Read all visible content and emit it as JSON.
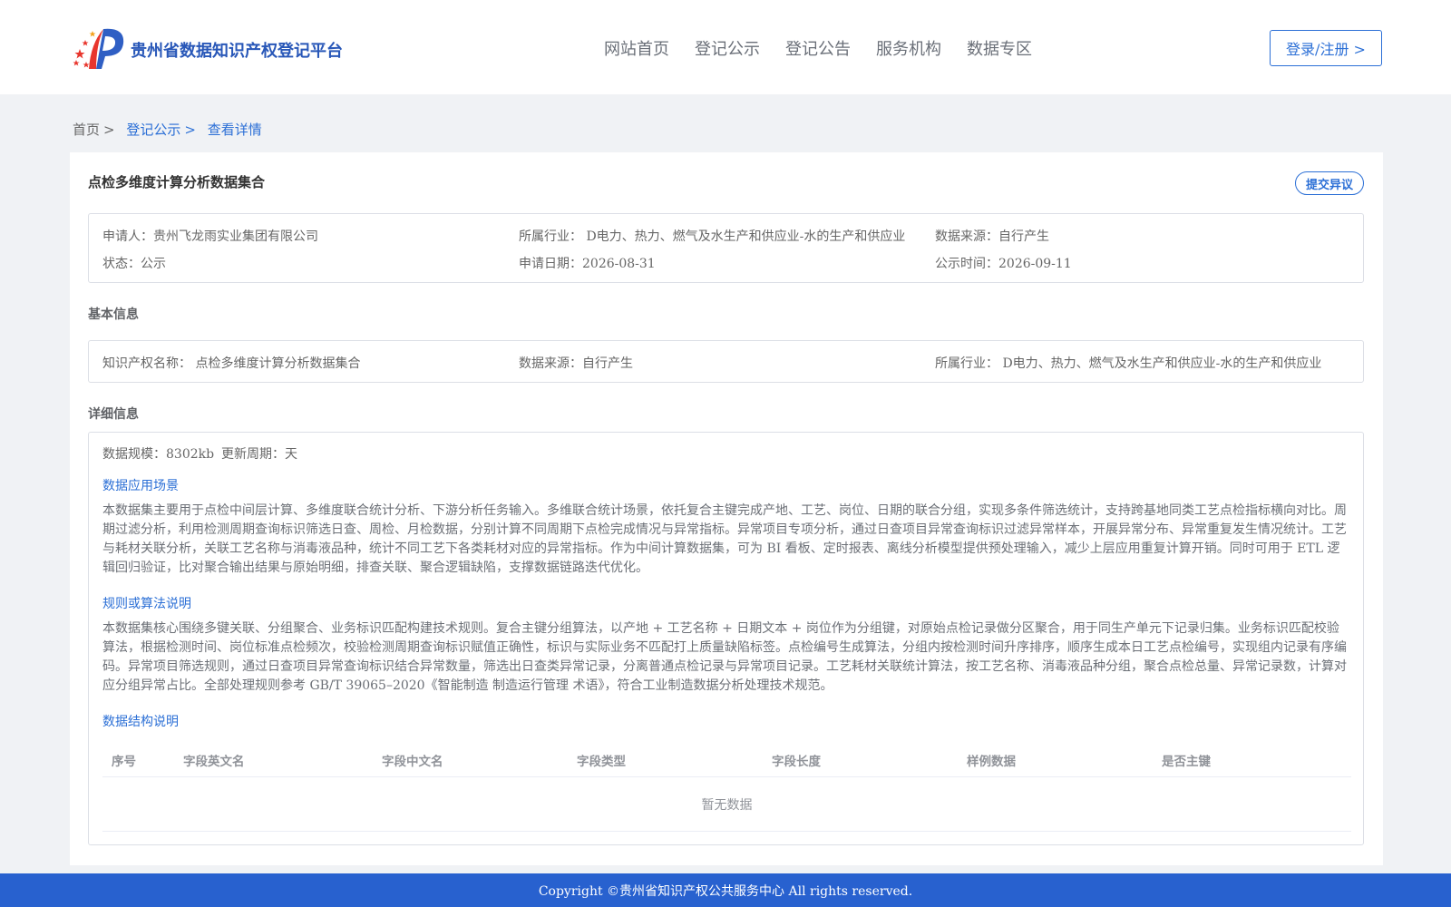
{
  "header": {
    "site_title": "贵州省数据知识产权登记平台",
    "nav": [
      "网站首页",
      "登记公示",
      "登记公告",
      "服务机构",
      "数据专区"
    ],
    "login_label": "登录/注册 >"
  },
  "breadcrumb": {
    "home": "首页",
    "section": "登记公示",
    "current": "查看详情"
  },
  "detail": {
    "title": "点检多维度计算分析数据集合",
    "objection_label": "提交异议",
    "summary": {
      "applicant": "申请人：贵州飞龙雨实业集团有限公司",
      "industry": "所属行业： D电力、热力、燃气及水生产和供应业-水的生产和供应业",
      "source": "数据来源：自行产生",
      "status": "状态：公示",
      "apply_date": "申请日期：2026-08-31",
      "publish_date": "公示时间：2026-09-11"
    }
  },
  "basic_info": {
    "title": "基本信息",
    "ip_name": "知识产权名称： 点检多维度计算分析数据集合",
    "source": "数据来源：自行产生",
    "industry": "所属行业： D电力、热力、燃气及水生产和供应业-水的生产和供应业"
  },
  "detail_info": {
    "title": "详细信息",
    "scale": "数据规模：8302kb",
    "cycle": "更新周期：天",
    "scene_title": "数据应用场景",
    "scene_text": "本数据集主要用于点检中间层计算、多维度联合统计分析、下游分析任务输入。多维联合统计场景，依托复合主键完成产地、工艺、岗位、日期的联合分组，实现多条件筛选统计，支持跨基地同类工艺点检指标横向对比。周期过滤分析，利用检测周期查询标识筛选日查、周检、月检数据，分别计算不同周期下点检完成情况与异常指标。异常项目专项分析，通过日查项目异常查询标识过滤异常样本，开展异常分布、异常重复发生情况统计。工艺与耗材关联分析，关联工艺名称与消毒液品种，统计不同工艺下各类耗材对应的异常指标。作为中间计算数据集，可为 BI 看板、定时报表、离线分析模型提供预处理输入，减少上层应用重复计算开销。同时可用于 ETL 逻辑回归验证，比对聚合输出结果与原始明细，排查关联、聚合逻辑缺陷，支撑数据链路迭代优化。",
    "rule_title": "规则或算法说明",
    "rule_text": "本数据集核心围绕多键关联、分组聚合、业务标识匹配构建技术规则。复合主键分组算法，以产地 + 工艺名称 + 日期文本 + 岗位作为分组键，对原始点检记录做分区聚合，用于同生产单元下记录归集。业务标识匹配校验算法，根据检测时间、岗位标准点检频次，校验检测周期查询标识赋值正确性，标识与实际业务不匹配打上质量缺陷标签。点检编号生成算法，分组内按检测时间升序排序，顺序生成本日工艺点检编号，实现组内记录有序编码。异常项目筛选规则，通过日查项目异常查询标识结合异常数量，筛选出日查类异常记录，分离普通点检记录与异常项目记录。工艺耗材关联统计算法，按工艺名称、消毒液品种分组，聚合点检总量、异常记录数，计算对应分组异常占比。全部处理规则参考 GB/T 39065–2020《智能制造 制造运行管理 术语》，符合工业制造数据分析处理技术规范。",
    "structure_title": "数据结构说明",
    "table_headers": [
      "序号",
      "字段英文名",
      "字段中文名",
      "字段类型",
      "字段长度",
      "样例数据",
      "是否主键"
    ],
    "empty_text": "暂无数据"
  },
  "footer": {
    "copyright": "Copyright ©贵州省知识产权公共服务中心 All rights reserved."
  },
  "colors": {
    "primary": "#2b6fd6",
    "footer_bg": "#2861cf",
    "page_bg": "#f0f2f5"
  }
}
